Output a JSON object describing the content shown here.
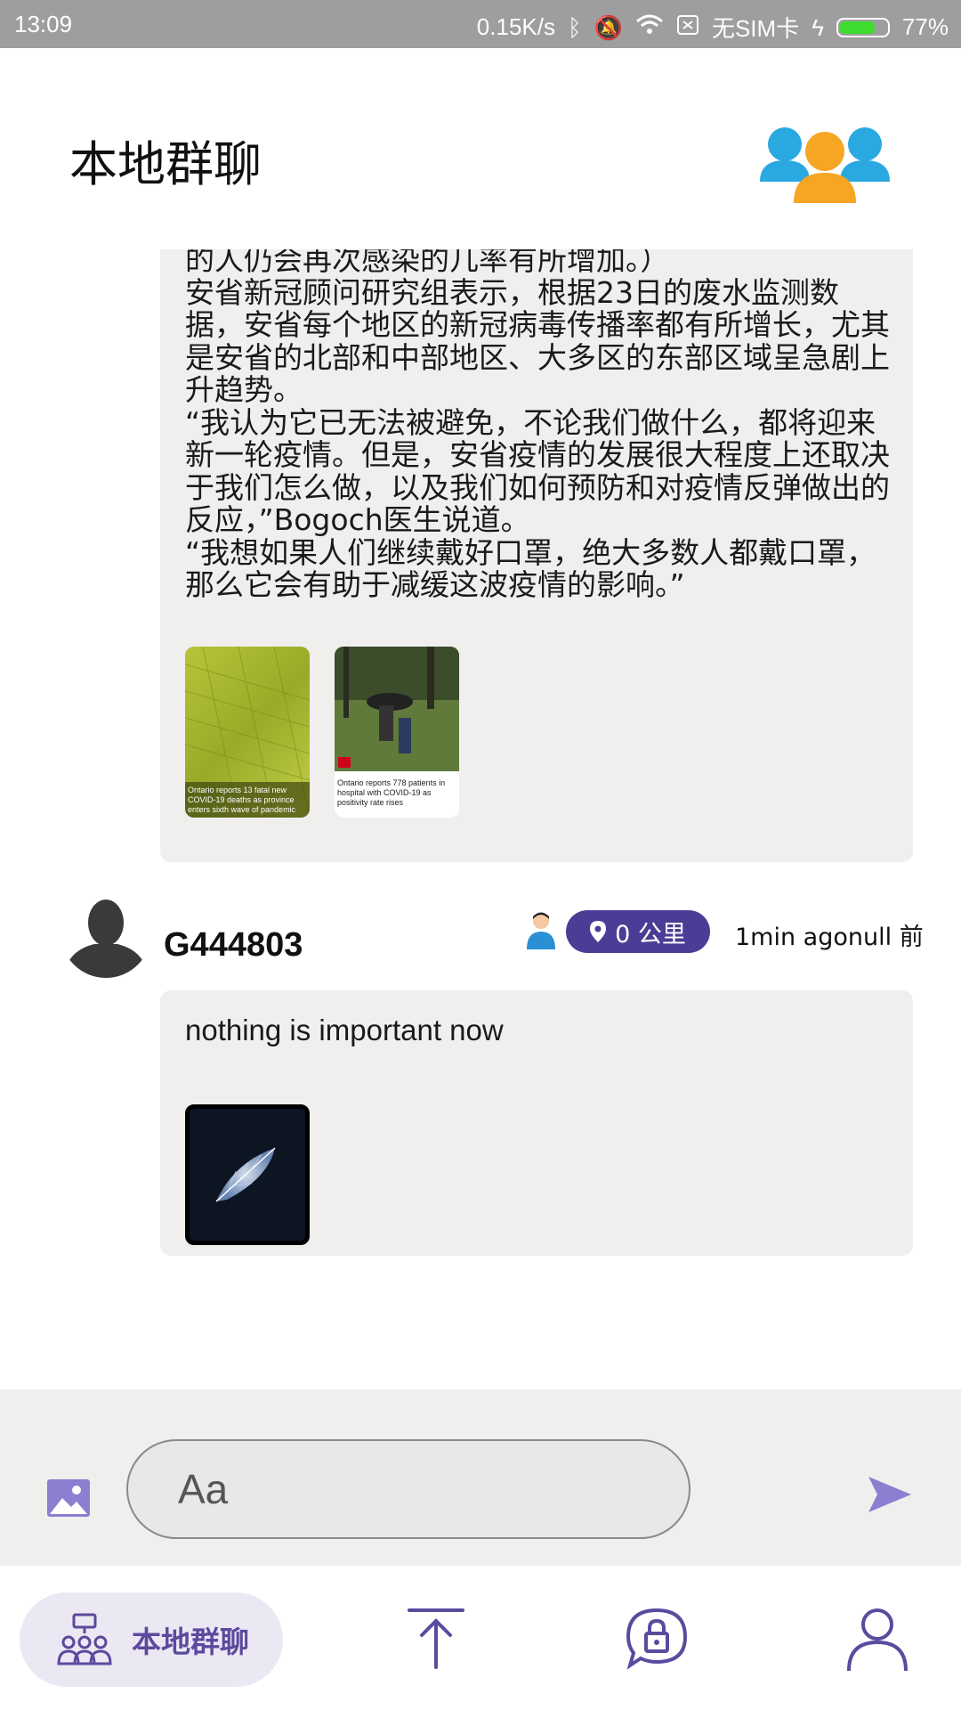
{
  "status_bar": {
    "time": "13:09",
    "speed": "0.15K/s",
    "sim": "无SIM卡",
    "battery_percent": "77%",
    "battery_level": 0.77
  },
  "header": {
    "title": "本地群聊"
  },
  "post1": {
    "text": "的人仍会再次感染的几率有所增加。）\n安省新冠顾问研究组表示，根据23日的废水监测数据，安省每个地区的新冠病毒传播率都有所增长，尤其是安省的北部和中部地区、大多区的东部区域呈急剧上升趋势。\n“我认为它已无法被避免，不论我们做什么，都将迎来新一轮疫情。但是，安省疫情的发展很大程度上还取决于我们怎么做，以及我们如何预防和对疫情反弹做出的反应，”Bogoch医生说道。\n“我想如果人们继续戴好口罩，绝大多数人都戴口罩，那么它会有助于减缓这波疫情的影响。”",
    "thumb1_caption": "Ontario reports 13 fatal new COVID-19 deaths as province enters sixth wave of pandemic",
    "thumb2_caption": "Ontario reports 778 patients in hospital with COVID-19 as positivity rate rises"
  },
  "post2": {
    "username": "G444803",
    "distance": "0 公里",
    "time_ago": "1min agonull 前",
    "text": "nothing is important now"
  },
  "composer": {
    "placeholder": "Aa"
  },
  "nav": {
    "local_chat_label": "本地群聊"
  },
  "colors": {
    "accent": "#4a3d96",
    "nav_accent": "#5b4a9e",
    "bubble": "#f0efee"
  }
}
